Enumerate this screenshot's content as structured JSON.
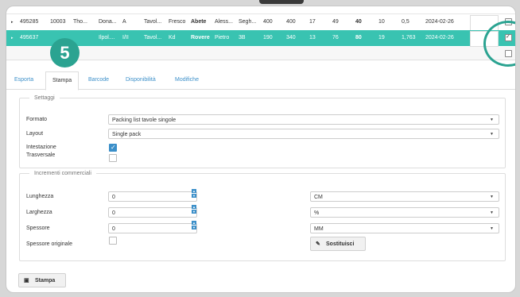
{
  "grid": {
    "rows": [
      {
        "cells": [
          "495285",
          "10003",
          "Tho...",
          "Dona...",
          "A",
          "Tavol...",
          "Fresco",
          "Abete",
          "Aless...",
          "Segh...",
          "400",
          "400",
          "17",
          "49",
          "40",
          "10",
          "0,5",
          "2024-02-26"
        ],
        "checked": false
      },
      {
        "cells": [
          "495637",
          "",
          "",
          "Ilpol....",
          "I/II",
          "Tavol...",
          "Kd",
          "Rovere",
          "Pietro",
          "3B",
          "190",
          "340",
          "13",
          "76",
          "80",
          "19",
          "1,763",
          "2024-02-26"
        ],
        "checked": true
      }
    ]
  },
  "step_badge": "5",
  "tabs": [
    {
      "label": "Esporta"
    },
    {
      "label": "Stampa"
    },
    {
      "label": "Barcode"
    },
    {
      "label": "Disponibilità"
    },
    {
      "label": "Modifiche"
    }
  ],
  "settings": {
    "legend": "Settaggi",
    "formato_label": "Formato",
    "formato_value": "Packing list tavole singole",
    "layout_label": "Layout",
    "layout_value": "Single pack",
    "intestazione_label": "Intestazione",
    "trasversale_label": "Trasversale"
  },
  "increments": {
    "legend": "Incrementi commerciali",
    "lunghezza_label": "Lunghezza",
    "lunghezza_value": "0",
    "larghezza_label": "Larghezza",
    "larghezza_value": "0",
    "spessore_label": "Spessore",
    "spessore_value": "0",
    "spessore_originale_label": "Spessore originale",
    "unit_lunghezza": "CM",
    "unit_larghezza": "%",
    "unit_spessore": "MM",
    "replace_button": "Sostituisci"
  },
  "print_button": "Stampa",
  "colors": {
    "accent": "#39c3b1",
    "badge": "#2ba391",
    "link": "#3b8fc9"
  }
}
